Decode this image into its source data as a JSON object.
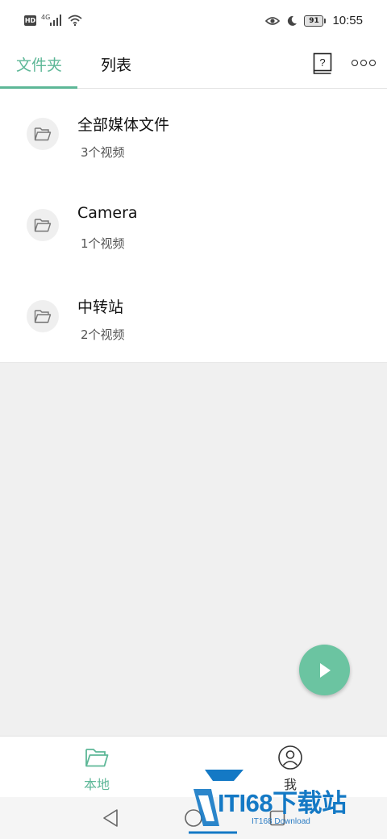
{
  "status_bar": {
    "hd_badge": "HD",
    "network": "4G",
    "battery_level": "91",
    "time": "10:55",
    "icons": [
      "signal-icon",
      "wifi-icon",
      "eye-icon",
      "moon-icon",
      "battery-icon"
    ]
  },
  "header": {
    "tabs": [
      {
        "label": "文件夹",
        "active": true
      },
      {
        "label": "列表",
        "active": false
      }
    ],
    "icons": [
      "help-book-icon",
      "more-icon"
    ]
  },
  "folders": [
    {
      "title": "全部媒体文件",
      "subtitle": "3个视频"
    },
    {
      "title": "Camera",
      "subtitle": "1个视频"
    },
    {
      "title": "中转站",
      "subtitle": "2个视频"
    }
  ],
  "fab": {
    "icon": "play-icon"
  },
  "bottom_nav": {
    "items": [
      {
        "label": "本地",
        "icon": "folder-icon",
        "active": true
      },
      {
        "label": "我",
        "icon": "user-icon",
        "active": false
      }
    ]
  },
  "watermark": {
    "text": "ITI68下载站",
    "sub": "IT168 Download"
  },
  "colors": {
    "accent": "#5db797",
    "fab": "#6bc4a1",
    "background": "#f0f0f0",
    "watermark_blue": "#1479c5"
  }
}
